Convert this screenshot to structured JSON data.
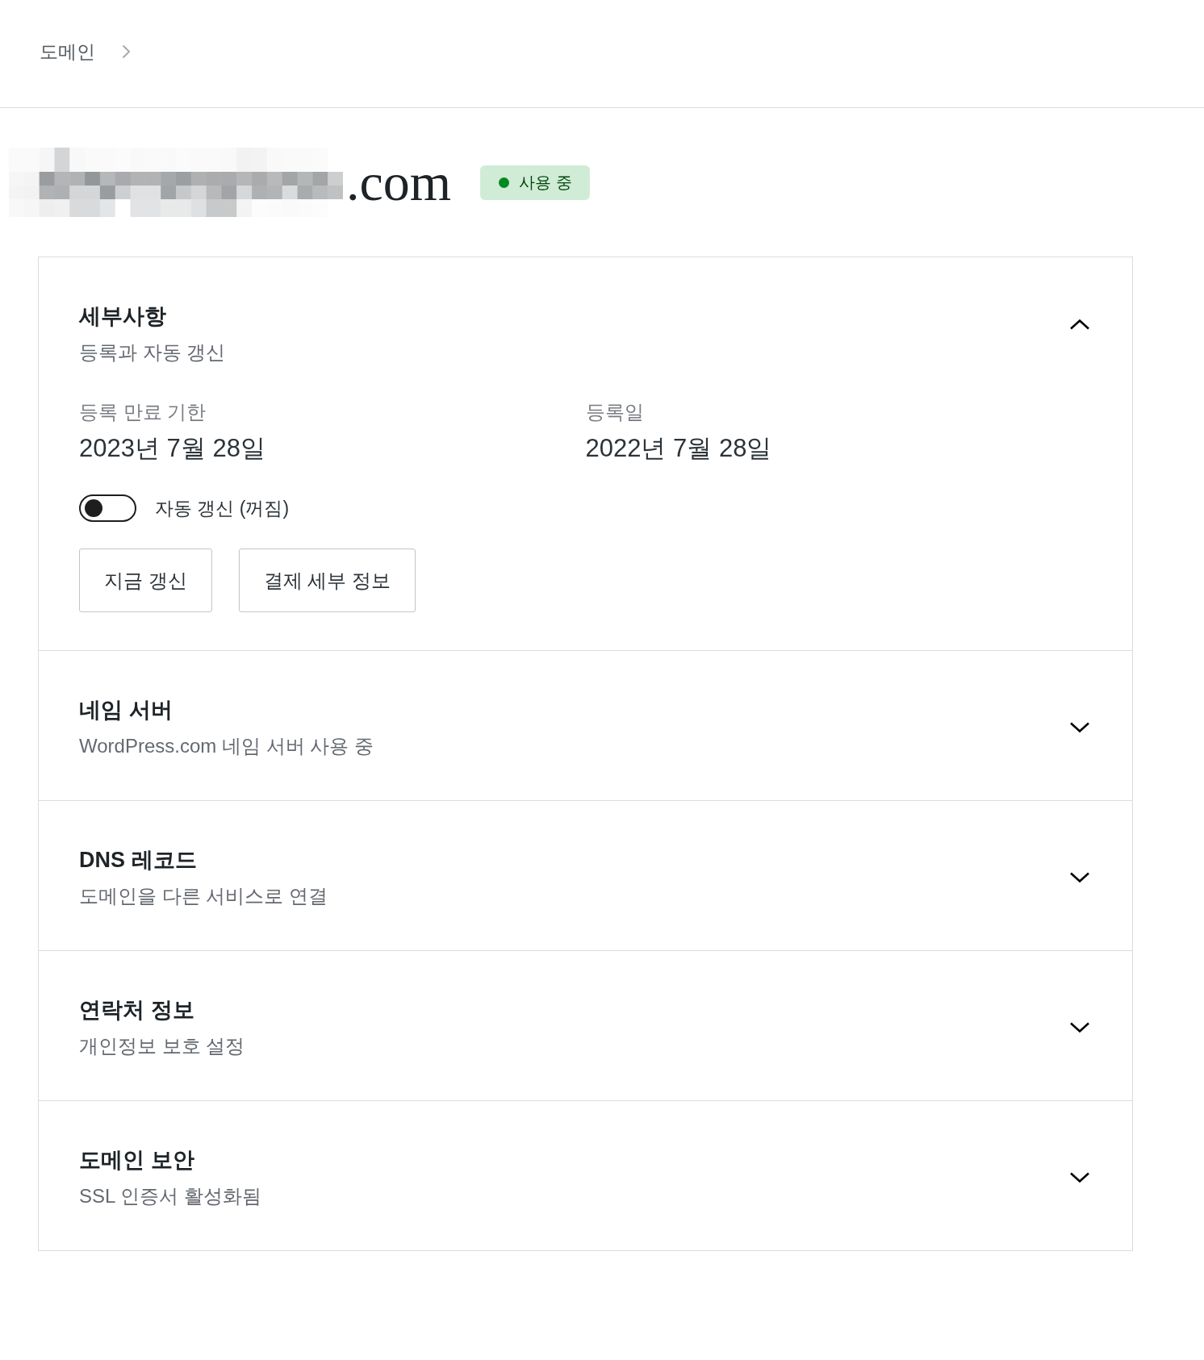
{
  "breadcrumb": [
    {
      "label": "도메인"
    }
  ],
  "domain": {
    "name": ".com",
    "name_pixelated": true,
    "status": {
      "label": "사용 중",
      "kind": "active"
    }
  },
  "sections": [
    {
      "title": "세부사항",
      "subtitle": "등록과 자동 갱신",
      "expanded": true,
      "fields": [
        {
          "label": "등록 만료 기한",
          "value": "2023년 7월 28일"
        },
        {
          "label": "등록일",
          "value": "2022년 7월 28일"
        }
      ],
      "auto_renew": {
        "label": "자동 갱신 (꺼짐)",
        "on": false
      },
      "buttons": [
        "지금 갱신",
        "결제 세부 정보"
      ]
    },
    {
      "title": "네임 서버",
      "subtitle": "WordPress.com 네임 서버 사용 중",
      "expanded": false
    },
    {
      "title": "DNS 레코드",
      "subtitle": "도메인을 다른 서비스로 연결",
      "expanded": false
    },
    {
      "title": "연락처 정보",
      "subtitle": "개인정보 보호 설정",
      "expanded": false
    },
    {
      "title": "도메인 보안",
      "subtitle": "SSL 인증서 활성화됨",
      "expanded": false
    }
  ]
}
